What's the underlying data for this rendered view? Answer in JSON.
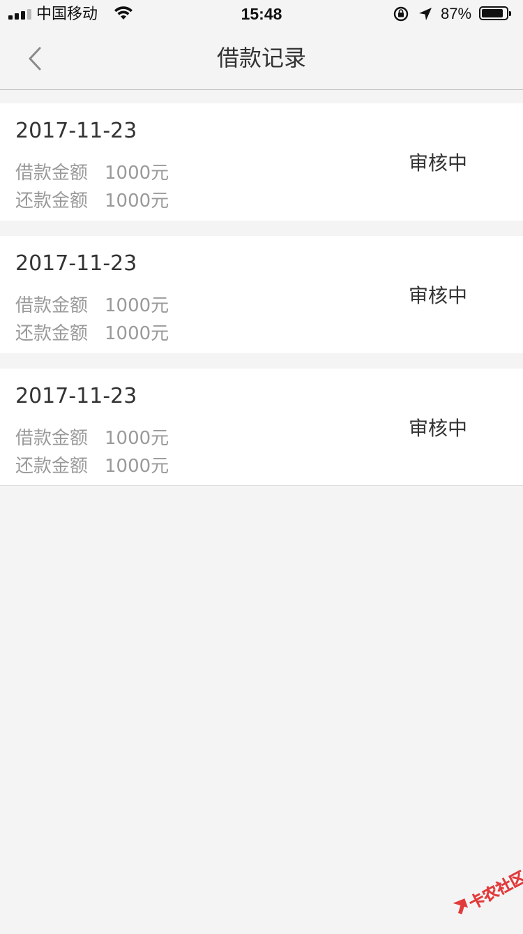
{
  "status_bar": {
    "carrier": "中国移动",
    "time": "15:48",
    "battery_percent": "87%",
    "battery_level": 0.87,
    "icons": [
      "signal-icon",
      "wifi-icon",
      "rotation-lock-icon",
      "location-arrow-icon",
      "battery-icon"
    ]
  },
  "nav": {
    "title": "借款记录",
    "back_icon": "chevron-left-icon"
  },
  "records": [
    {
      "date": "2017-11-23",
      "loan_label": "借款金额",
      "loan_amount": "1000元",
      "repay_label": "还款金额",
      "repay_amount": "1000元",
      "status": "审核中"
    },
    {
      "date": "2017-11-23",
      "loan_label": "借款金额",
      "loan_amount": "1000元",
      "repay_label": "还款金额",
      "repay_amount": "1000元",
      "status": "审核中"
    },
    {
      "date": "2017-11-23",
      "loan_label": "借款金额",
      "loan_amount": "1000元",
      "repay_label": "还款金额",
      "repay_amount": "1000元",
      "status": "审核中"
    }
  ],
  "watermark": {
    "text": "卡农社区"
  },
  "colors": {
    "background": "#f4f4f4",
    "card": "#ffffff",
    "primary_text": "#333333",
    "secondary_text": "#9a9a9a",
    "watermark": "#e23b3b"
  }
}
